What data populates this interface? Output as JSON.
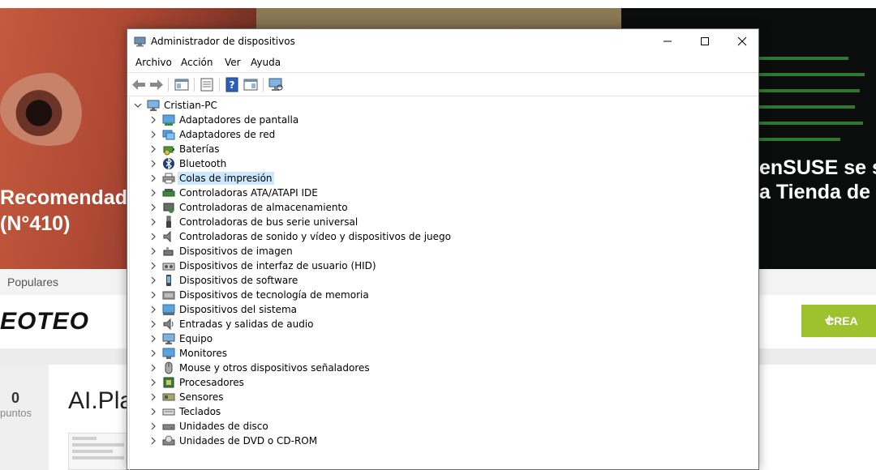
{
  "background_page": {
    "hero_left_title_line1": "Recomendado",
    "hero_left_title_line2": "(N°410)",
    "hero_right_title_line1": "enSUSE se su",
    "hero_right_title_line2": "a Tienda de W",
    "tab_label": "Populares",
    "logo_text": "EOTEO",
    "create_button_label": "CREA",
    "points_value": "0",
    "points_label": "puntos",
    "article_title": "AI.Pla"
  },
  "window": {
    "title": "Administrador de dispositivos",
    "menu": [
      "Archivo",
      "Acción",
      "Ver",
      "Ayuda"
    ],
    "toolbar": [
      {
        "icon": "back-arrow-icon"
      },
      {
        "icon": "forward-arrow-icon"
      },
      {
        "icon": "show-hide-console-tree-icon"
      },
      {
        "icon": "properties-icon"
      },
      {
        "icon": "help-icon"
      },
      {
        "icon": "action-pane-icon"
      },
      {
        "icon": "scan-hardware-icon"
      }
    ],
    "tree": {
      "root": "Cristian-PC",
      "categories": [
        {
          "label": "Adaptadores de pantalla",
          "icon": "display-adapter-icon"
        },
        {
          "label": "Adaptadores de red",
          "icon": "network-adapter-icon"
        },
        {
          "label": "Baterías",
          "icon": "battery-icon"
        },
        {
          "label": "Bluetooth",
          "icon": "bluetooth-icon"
        },
        {
          "label": "Colas de impresión",
          "icon": "printer-icon",
          "selected": true
        },
        {
          "label": "Controladoras ATA/ATAPI IDE",
          "icon": "ide-controller-icon"
        },
        {
          "label": "Controladoras de almacenamiento",
          "icon": "storage-controller-icon"
        },
        {
          "label": "Controladoras de bus serie universal",
          "icon": "usb-icon"
        },
        {
          "label": "Controladoras de sonido y vídeo y dispositivos de juego",
          "icon": "speaker-icon"
        },
        {
          "label": "Dispositivos de imagen",
          "icon": "camera-icon"
        },
        {
          "label": "Dispositivos de interfaz de usuario (HID)",
          "icon": "hid-icon"
        },
        {
          "label": "Dispositivos de software",
          "icon": "software-device-icon"
        },
        {
          "label": "Dispositivos de tecnología de memoria",
          "icon": "memory-icon"
        },
        {
          "label": "Dispositivos del sistema",
          "icon": "system-device-icon"
        },
        {
          "label": "Entradas y salidas de audio",
          "icon": "audio-io-icon"
        },
        {
          "label": "Equipo",
          "icon": "computer-icon"
        },
        {
          "label": "Monitores",
          "icon": "monitor-icon"
        },
        {
          "label": "Mouse y otros dispositivos señaladores",
          "icon": "mouse-icon"
        },
        {
          "label": "Procesadores",
          "icon": "processor-icon"
        },
        {
          "label": "Sensores",
          "icon": "sensor-icon"
        },
        {
          "label": "Teclados",
          "icon": "keyboard-icon"
        },
        {
          "label": "Unidades de disco",
          "icon": "disk-drive-icon"
        },
        {
          "label": "Unidades de DVD o CD-ROM",
          "icon": "dvd-drive-icon"
        }
      ]
    }
  },
  "colors": {
    "selection": "#cce8ff",
    "create_button": "#9dc22d"
  }
}
